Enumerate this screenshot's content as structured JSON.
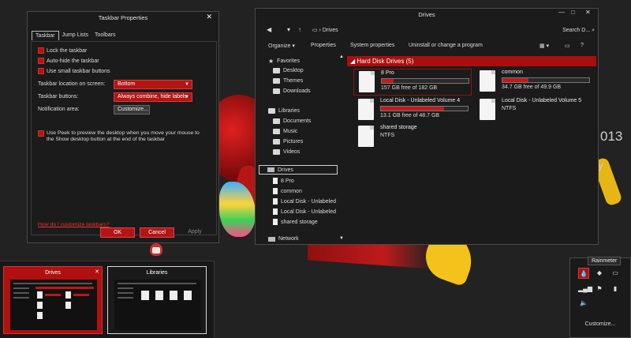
{
  "taskbar_properties": {
    "title": "Taskbar Properties",
    "close": "✕",
    "tabs": [
      "Taskbar",
      "Jump Lists",
      "Toolbars"
    ],
    "checkboxes": [
      "Lock the taskbar",
      "Auto-hide the taskbar",
      "Use small taskbar buttons"
    ],
    "location_label": "Taskbar location on screen:",
    "location_value": "Bottom",
    "buttons_label": "Taskbar buttons:",
    "buttons_value": "Always combine, hide labels",
    "notification_label": "Notification area:",
    "customize_button": "Customize...",
    "peek_text": "Use Peek to preview the desktop when you move your mouse to the Show desktop button at the end of the taskbar",
    "help_link": "How do I customize taskbars?",
    "ok": "OK",
    "cancel": "Cancel",
    "apply": "Apply"
  },
  "drives_window": {
    "title": "Drives",
    "controls": [
      "—",
      "□",
      "✕"
    ],
    "address": "Drives",
    "search_placeholder": "Search D...",
    "commands": [
      "Organize ▾",
      "Properties",
      "System properties",
      "Uninstall or change a program"
    ],
    "nav": {
      "favorites": "Favorites",
      "favorites_items": [
        "Desktop",
        "Themes",
        "Downloads"
      ],
      "libraries": "Libraries",
      "libraries_items": [
        "Documents",
        "Music",
        "Pictures",
        "Videos"
      ],
      "drives": "Drives",
      "drives_items": [
        "8 Pro",
        "common",
        "Local Disk - Unlabeled",
        "Local Disk - Unlabeled",
        "shared storage"
      ],
      "network": "Network"
    },
    "group_header": "Hard Disk Drives (5)",
    "drives": [
      {
        "name": "8 Pro",
        "info": "157 GB free of 182 GB",
        "used": 0.14
      },
      {
        "name": "common",
        "info": "34.7 GB free of 49.9 GB",
        "used": 0.3
      },
      {
        "name": "Local Disk - Unlabeled Volume 4",
        "info": "13.1 GB free of 48.7 GB",
        "used": 0.73
      },
      {
        "name": "Local Disk - Unlabeled Volume 5",
        "info": "NTFS"
      },
      {
        "name": "shared storage",
        "info": "NTFS"
      }
    ]
  },
  "thumbnails": [
    {
      "title": "Drives",
      "close": "✕"
    },
    {
      "title": "Libraries"
    }
  ],
  "wallpaper_text": [
    "013",
    "y"
  ],
  "tray": {
    "tooltip": "Rainmeter",
    "customize": "Customize..."
  }
}
